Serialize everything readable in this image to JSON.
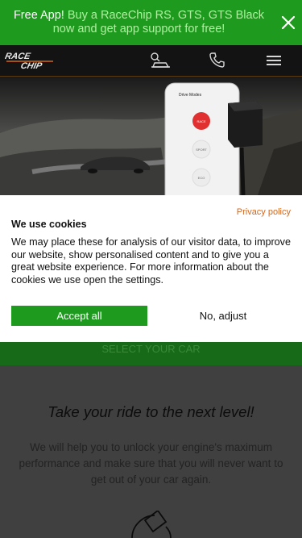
{
  "banner": {
    "free_app": "Free App!",
    "promo_text": "Buy a RaceChip RS, GTS, GTS Black now and get app support for free!",
    "close_icon": "close-icon"
  },
  "header": {
    "logo_text": "RACE CHIP",
    "car_finder_icon": "car-finder-icon",
    "phone_icon": "phone-icon",
    "menu_icon": "hamburger-menu-icon"
  },
  "hero": {
    "app_screen_title": "Drive Modes"
  },
  "cookie_dialog": {
    "title": "We use cookies",
    "privacy_link": "Privacy policy",
    "body": "We may place these for analysis of our visitor data, to improve our website, show personalised content and to give you a great website experience. For more information about the cookies we use open the settings.",
    "accept_label": "Accept all",
    "adjust_label": "No, adjust"
  },
  "select_car": {
    "label": "SELECT YOUR CAR"
  },
  "main": {
    "tagline": "Take your ride to the next level!",
    "description": "We will help you to unlock your engine's maximum performance and make sure that you will never want to get out of your car again."
  },
  "colors": {
    "brand_green": "#1e9a1e",
    "privacy_orange": "#d4661b"
  }
}
